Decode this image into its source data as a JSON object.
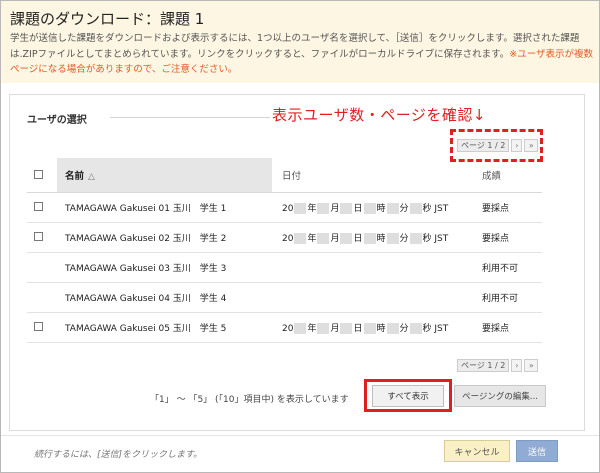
{
  "header": {
    "title": "課題のダウンロード：課題 1",
    "desc_main": "学生が送信した課題をダウンロードおよび表示するには、1つ以上のユーザ名を選択して、［送信］をクリックします。選択された課題は.ZIPファイルとしてまとめられています。リンクをクリックすると、ファイルがローカルドライブに保存されます。",
    "desc_warning": "※ユーザ表示が複数ページになる場合がありますので、ご注意ください。"
  },
  "section": {
    "label": "ユーザの選択"
  },
  "annotation": {
    "text": "表示ユーザ数・ページを確認↓"
  },
  "pager": {
    "text": "ページ 1 / 2",
    "next": "›",
    "last": "»"
  },
  "table": {
    "headers": {
      "name": "名前",
      "date": "日付",
      "grade": "成績"
    },
    "rows": [
      {
        "name": "TAMAGAWA Gakusei 01 玉川　学生 1",
        "date_prefix": "20",
        "y": "年",
        "m": "月",
        "d": "日",
        "h": "時",
        "mi": "分",
        "s": "秒 JST",
        "grade": "要採点",
        "selectable": true
      },
      {
        "name": "TAMAGAWA Gakusei 02 玉川　学生 2",
        "date_prefix": "20",
        "y": "年",
        "m": "月",
        "d": "日",
        "h": "時",
        "mi": "分",
        "s": "秒 JST",
        "grade": "要採点",
        "selectable": true
      },
      {
        "name": "TAMAGAWA Gakusei 03 玉川　学生 3",
        "grade": "利用不可",
        "selectable": false
      },
      {
        "name": "TAMAGAWA Gakusei 04 玉川　学生 4",
        "grade": "利用不可",
        "selectable": false
      },
      {
        "name": "TAMAGAWA Gakusei 05 玉川　学生 5",
        "date_prefix": "20",
        "y": "年",
        "m": "月",
        "d": "日",
        "h": "時",
        "mi": "分",
        "s": "秒 JST",
        "grade": "要採点",
        "selectable": true
      }
    ]
  },
  "footer": {
    "showing_text": "「1」 ～ 「5」 (「10」項目中) を表示しています",
    "show_all": "すべて表示",
    "edit_paging": "ページングの編集..."
  },
  "bottom": {
    "continue_text": "続行するには、[送信]をクリックします。",
    "cancel": "キャンセル",
    "submit": "送信"
  },
  "colors": {
    "header_bg": "#fdf6e3",
    "warning": "#e05a28",
    "highlight": "#e02020",
    "submit_bg": "#90abd4",
    "cancel_bg": "#faf0c5"
  }
}
